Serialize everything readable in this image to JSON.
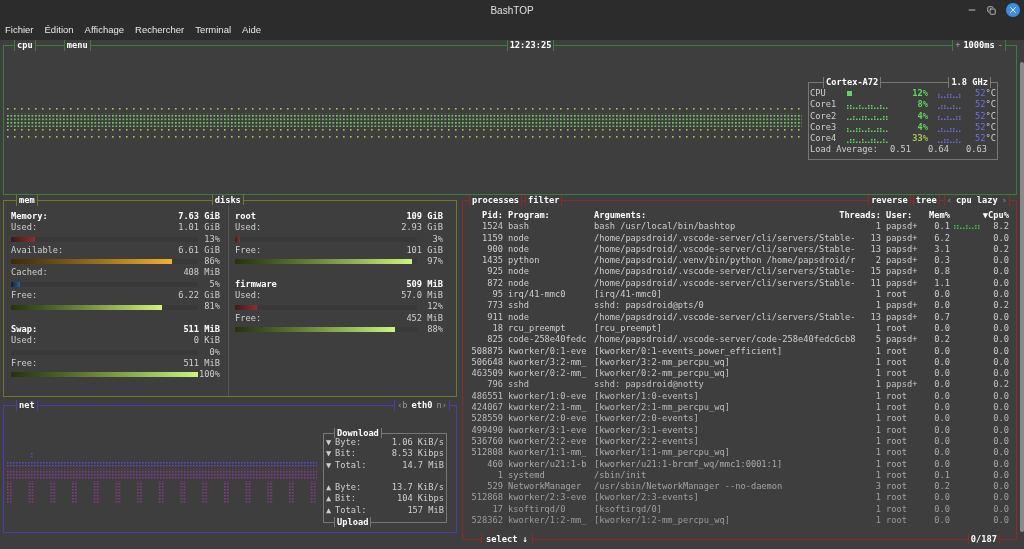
{
  "window": {
    "title": "BashTOP"
  },
  "menu": [
    "Fichier",
    "Édition",
    "Affichage",
    "Rechercher",
    "Terminal",
    "Aide"
  ],
  "cpu": {
    "title": "cpu",
    "menu": "menu",
    "clock": "12:23:25",
    "rate_plus": "+",
    "rate": "1000ms",
    "rate_minus": "-",
    "model": "Cortex-A72",
    "freq": "1.8 GHz",
    "cores": [
      {
        "kind": "total",
        "name": "CPU",
        "percent": "12%",
        "color": "#5fd75f",
        "temp": "52",
        "unit": "°C"
      },
      {
        "kind": "core",
        "name": "Core1",
        "percent": "8%",
        "color": "#5fd75f",
        "temp": "52",
        "unit": "°C"
      },
      {
        "kind": "core",
        "name": "Core2",
        "percent": "4%",
        "color": "#5fd75f",
        "temp": "52",
        "unit": "°C"
      },
      {
        "kind": "core",
        "name": "Core3",
        "percent": "4%",
        "color": "#5fd75f",
        "temp": "52",
        "unit": "°C"
      },
      {
        "kind": "core",
        "name": "Core4",
        "percent": "33%",
        "color": "#a8c84a",
        "temp": "52",
        "unit": "°C"
      }
    ],
    "load_label": "Load Average:",
    "load": [
      "0.51",
      "0.64",
      "0.63"
    ]
  },
  "mem": {
    "title": "mem",
    "sections": [
      {
        "label": "Memory:",
        "total": "7.63 GiB",
        "rows": [
          {
            "kind": "used",
            "label": "Used:",
            "value": "1.01 GiB",
            "percent": "13%",
            "level": 0.13
          },
          {
            "kind": "available",
            "label": "Available:",
            "value": "6.61 GiB",
            "percent": "86%",
            "level": 0.86
          },
          {
            "kind": "cached",
            "label": "Cached:",
            "value": "408 MiB",
            "percent": "5%",
            "level": 0.05
          },
          {
            "kind": "free",
            "label": "Free:",
            "value": "6.22 GiB",
            "percent": "81%",
            "level": 0.81
          }
        ]
      },
      {
        "label": "Swap:",
        "total": "511 MiB",
        "rows": [
          {
            "kind": "used",
            "label": "Used:",
            "value": "0 KiB",
            "percent": "0%",
            "level": 0
          },
          {
            "kind": "free",
            "label": "Free:",
            "value": "511 MiB",
            "percent": "100%",
            "level": 1
          }
        ]
      }
    ]
  },
  "disks": {
    "title": "disks",
    "items": [
      {
        "label": "root",
        "total": "109 GiB",
        "rows": [
          {
            "kind": "used",
            "label": "Used:",
            "value": "2.93 GiB",
            "percent": "3%",
            "level": 0.03
          },
          {
            "kind": "free",
            "label": "Free:",
            "value": "101 GiB",
            "percent": "97%",
            "level": 0.97
          }
        ]
      },
      {
        "label": "firmware",
        "total": "509 MiB",
        "rows": [
          {
            "kind": "used",
            "label": "Used:",
            "value": "57.0 MiB",
            "percent": "12%",
            "level": 0.12
          },
          {
            "kind": "free",
            "label": "Free:",
            "value": "452 MiB",
            "percent": "88%",
            "level": 0.88
          }
        ]
      }
    ]
  },
  "net": {
    "title": "net",
    "prev": "‹b",
    "iface": "eth0",
    "next": "n›",
    "download_title": "Download",
    "upload_title": "Upload",
    "download": [
      {
        "arrow": "▼",
        "label": "Byte:",
        "value": "1.06 KiB/s"
      },
      {
        "arrow": "▼",
        "label": "Bit:",
        "value": "8.53 Kibps"
      },
      {
        "arrow": "▼",
        "label": "Total:",
        "value": "14.7 MiB"
      }
    ],
    "upload": [
      {
        "arrow": "▲",
        "label": "Byte:",
        "value": "13.7 KiB/s"
      },
      {
        "arrow": "▲",
        "label": "Bit:",
        "value": "104 Kibps"
      },
      {
        "arrow": "▲",
        "label": "Total:",
        "value": "157 MiB"
      }
    ]
  },
  "processes": {
    "title": "processes",
    "filter": "filter",
    "reverse": "reverse",
    "tree": "tree",
    "sort_prev": "‹",
    "sort": "cpu lazy",
    "sort_next": "›",
    "select": "select ↓",
    "count": "0/187",
    "columns": [
      "Pid:",
      "Program:",
      "Arguments:",
      "Threads:",
      "User:",
      "Mem%",
      "▼Cpu%"
    ],
    "rows": [
      {
        "graph": true,
        "cells": [
          "1524",
          "bash",
          "bash /usr/local/bin/bashtop",
          "1",
          "papsd+",
          "0.1",
          "8.2"
        ]
      },
      {
        "graph": false,
        "cells": [
          "1159",
          "node",
          "/home/papsdroid/.vscode-server/cli/servers/Stable-",
          "13",
          "papsd+",
          "6.2",
          "0.0"
        ]
      },
      {
        "graph": false,
        "cells": [
          "900",
          "node",
          "/home/papsdroid/.vscode-server/cli/servers/Stable-",
          "13",
          "papsd+",
          "3.1",
          "0.2"
        ]
      },
      {
        "graph": false,
        "cells": [
          "1435",
          "python",
          "/home/papsdroid/.venv/bin/python /home/papsdroid/r",
          "2",
          "papsd+",
          "0.3",
          "0.0"
        ]
      },
      {
        "graph": false,
        "cells": [
          "925",
          "node",
          "/home/papsdroid/.vscode-server/cli/servers/Stable-",
          "15",
          "papsd+",
          "0.8",
          "0.0"
        ]
      },
      {
        "graph": false,
        "cells": [
          "872",
          "node",
          "/home/papsdroid/.vscode-server/cli/servers/Stable-",
          "11",
          "papsd+",
          "1.1",
          "0.0"
        ]
      },
      {
        "graph": false,
        "cells": [
          "95",
          "irq/41-mmc0",
          "[irq/41-mmc0]",
          "1",
          "root",
          "0.0",
          "0.0"
        ]
      },
      {
        "graph": false,
        "cells": [
          "773",
          "sshd",
          "sshd: papsdroid@pts/0",
          "1",
          "papsd+",
          "0.0",
          "0.2"
        ]
      },
      {
        "graph": false,
        "cells": [
          "911",
          "node",
          "/home/papsdroid/.vscode-server/cli/servers/Stable-",
          "13",
          "papsd+",
          "0.7",
          "0.0"
        ]
      },
      {
        "graph": false,
        "cells": [
          "18",
          "rcu_preempt",
          "[rcu_preempt]",
          "1",
          "root",
          "0.0",
          "0.0"
        ]
      },
      {
        "graph": false,
        "cells": [
          "825",
          "code-258e40fedc",
          "/home/papsdroid/.vscode-server/code-258e40fedc6cb8",
          "5",
          "papsd+",
          "0.2",
          "0.0"
        ]
      },
      {
        "graph": false,
        "cells": [
          "508875",
          "kworker/0:1-eve",
          "[kworker/0:1-events_power_efficient]",
          "1",
          "root",
          "0.0",
          "0.0"
        ]
      },
      {
        "graph": false,
        "cells": [
          "506648",
          "kworker/3:2-mm_",
          "[kworker/3:2-mm_percpu_wq]",
          "1",
          "root",
          "0.0",
          "0.0"
        ]
      },
      {
        "graph": false,
        "cells": [
          "463509",
          "kworker/0:2-mm_",
          "[kworker/0:2-mm_percpu_wq]",
          "1",
          "root",
          "0.0",
          "0.0"
        ]
      },
      {
        "graph": false,
        "cells": [
          "796",
          "sshd",
          "sshd: papsdroid@notty",
          "1",
          "papsd+",
          "0.0",
          "0.2"
        ]
      },
      {
        "graph": false,
        "cells": [
          "486551",
          "kworker/1:0-eve",
          "[kworker/1:0-events]",
          "1",
          "root",
          "0.0",
          "0.0"
        ]
      },
      {
        "graph": false,
        "cells": [
          "424067",
          "kworker/2:1-mm_",
          "[kworker/2:1-mm_percpu_wq]",
          "1",
          "root",
          "0.0",
          "0.0"
        ]
      },
      {
        "graph": false,
        "cells": [
          "528559",
          "kworker/2:0-eve",
          "[kworker/2:0-events]",
          "1",
          "root",
          "0.0",
          "0.0"
        ]
      },
      {
        "graph": false,
        "cells": [
          "499490",
          "kworker/3:1-eve",
          "[kworker/3:1-events]",
          "1",
          "root",
          "0.0",
          "0.0"
        ]
      },
      {
        "graph": false,
        "cells": [
          "536760",
          "kworker/2:2-eve",
          "[kworker/2:2-events]",
          "1",
          "root",
          "0.0",
          "0.0"
        ]
      },
      {
        "graph": false,
        "cells": [
          "512808",
          "kworker/1:1-mm_",
          "[kworker/1:1-mm_percpu_wq]",
          "1",
          "root",
          "0.0",
          "0.0"
        ]
      },
      {
        "graph": false,
        "cells": [
          "460",
          "kworker/u21:1-b",
          "[kworker/u21:1-brcmf_wq/mmc1:0001:1]",
          "1",
          "root",
          "0.0",
          "0.0"
        ]
      },
      {
        "graph": false,
        "cells": [
          "1",
          "systemd",
          "/sbin/init",
          "1",
          "root",
          "0.1",
          "0.0"
        ]
      },
      {
        "graph": false,
        "cells": [
          "529",
          "NetworkManager",
          "/usr/sbin/NetworkManager --no-daemon",
          "3",
          "root",
          "0.2",
          "0.0"
        ]
      },
      {
        "graph": false,
        "cells": [
          "512868",
          "kworker/2:3-eve",
          "[kworker/2:3-events]",
          "1",
          "root",
          "0.0",
          "0.0"
        ]
      },
      {
        "graph": false,
        "cells": [
          "17",
          "ksoftirqd/0",
          "[ksoftirqd/0]",
          "1",
          "root",
          "0.0",
          "0.0"
        ]
      },
      {
        "graph": false,
        "cells": [
          "528362",
          "kworker/1:2-mm_",
          "[kworker/1:2-mm_percpu_wq]",
          "1",
          "root",
          "0.0",
          "0.0"
        ]
      }
    ]
  }
}
